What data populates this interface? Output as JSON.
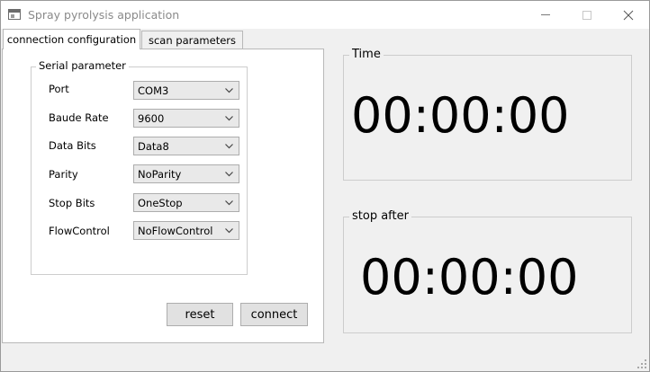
{
  "window": {
    "title": "Spray pyrolysis application",
    "icon": "app-window-icon",
    "controls": {
      "minimize": "–",
      "maximize": "☐",
      "close": "✕"
    }
  },
  "tabs": [
    {
      "label": "connection configuration",
      "active": true
    },
    {
      "label": "scan parameters",
      "active": false
    }
  ],
  "serial": {
    "title": "Serial parameter",
    "fields": [
      {
        "label": "Port",
        "value": "COM3"
      },
      {
        "label": "Baude Rate",
        "value": "9600"
      },
      {
        "label": "Data Bits",
        "value": "Data8"
      },
      {
        "label": "Parity",
        "value": "NoParity"
      },
      {
        "label": "Stop Bits",
        "value": "OneStop"
      },
      {
        "label": "FlowControl",
        "value": "NoFlowControl"
      }
    ]
  },
  "buttons": {
    "reset": "reset",
    "connect": "connect"
  },
  "time": {
    "title": "Time",
    "value": "00:00:00"
  },
  "stop_after": {
    "title": "stop after",
    "value": "00:00:00"
  }
}
